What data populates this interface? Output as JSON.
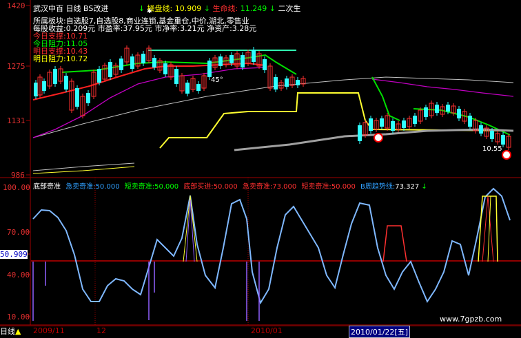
{
  "top_bar": {
    "stock_name": "武汉中百",
    "period": "日线",
    "formula": "BS改进",
    "arrow_down_1": "↓",
    "op_line_label": "操盘线:",
    "op_line_value": "10.909",
    "arrow_down_2": "↓",
    "life_line_label": "生命线:",
    "life_line_value": "11.249",
    "arrow_down_3": "↓",
    "second_label": "二次生"
  },
  "info_panel": {
    "sector_line": "所属板块:自选股7,自选股8,商业连锁,基金重仓,中价,湖北,零售业",
    "eps_line": "每股收益:0.209元  市盈率:37.95元  市净率:3.21元  净资产:3.28元",
    "rows": [
      {
        "label": "今日支撑:",
        "value": "10.71",
        "color": "#ff3030"
      },
      {
        "label": "今日阻力:",
        "value": "11.05",
        "color": "#00ff00"
      },
      {
        "label": "明日支撑:",
        "value": "10.43",
        "color": "#ff3030"
      },
      {
        "label": "明日阻力:",
        "value": "10.72",
        "color": "#ffff00"
      }
    ]
  },
  "price_axis": [
    "1420",
    "1275",
    "1131",
    "986"
  ],
  "annotations": {
    "angle": "45°",
    "last_price": "10.55"
  },
  "indicator_bar": {
    "items": [
      {
        "label": "底部奇准",
        "color": "#ff3030"
      },
      {
        "label": "急卖奇准:",
        "value": "50.000",
        "color": "#30a0ff"
      },
      {
        "label": "短卖奇准:",
        "value": "50.000",
        "color": "#00ff00"
      },
      {
        "label": "底部买进:",
        "value": "50.000",
        "color": "#ff3030"
      },
      {
        "label": "急卖奇准:",
        "value": "73.000",
        "color": "#ff3030"
      },
      {
        "label": "短卖奇准:",
        "value": "50.000",
        "color": "#ff3030"
      },
      {
        "label": "B周趋势线:",
        "value": "73.327",
        "color": "#30a0ff"
      }
    ],
    "arrow": "↓"
  },
  "indicator_axis": [
    "100.00",
    "70.00",
    "50.909",
    "40.00",
    "10.00"
  ],
  "bottom_bar": {
    "period_button": "日线",
    "triangle": "▲",
    "dates": [
      "2009/11",
      "12",
      "2010/01"
    ],
    "selected_date": "2010/01/22",
    "weekday": "五",
    "watermark": "www.7gpzb.com"
  },
  "colors": {
    "up": "#ff3030",
    "down": "#30ffff",
    "axis": "#a00000",
    "oscillator": "#7fb8ff",
    "threshold": "#c00000"
  }
}
